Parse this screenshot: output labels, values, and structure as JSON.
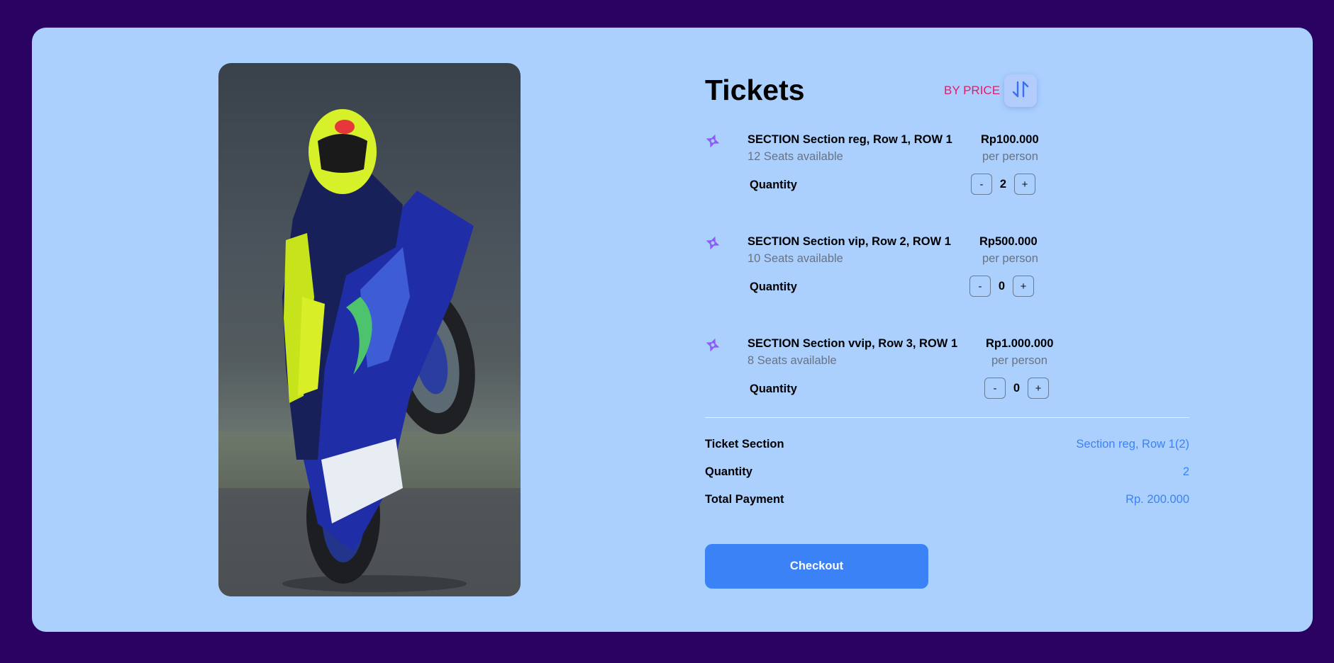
{
  "page": {
    "title": "Tickets",
    "sort_label": "BY PRICE"
  },
  "tickets": [
    {
      "name": "SECTION Section reg, Row 1, ROW 1",
      "seats": "12 Seats available",
      "price": "Rp100.000",
      "per": "per person",
      "quantity_label": "Quantity",
      "minus": "-",
      "plus": "+",
      "quantity": "2"
    },
    {
      "name": "SECTION Section vip, Row 2, ROW 1",
      "seats": "10 Seats available",
      "price": "Rp500.000",
      "per": "per person",
      "quantity_label": "Quantity",
      "minus": "-",
      "plus": "+",
      "quantity": "0"
    },
    {
      "name": "SECTION Section vvip, Row 3, ROW 1",
      "seats": "8 Seats available",
      "price": "Rp1.000.000",
      "per": "per person",
      "quantity_label": "Quantity",
      "minus": "-",
      "plus": "+",
      "quantity": "0"
    }
  ],
  "summary": {
    "section_label": "Ticket Section",
    "section_value": "Section reg, Row 1(2)",
    "quantity_label": "Quantity",
    "quantity_value": "2",
    "total_label": "Total Payment",
    "total_value": "Rp. 200.000"
  },
  "checkout_label": "Checkout",
  "colors": {
    "background": "#2a0262",
    "card": "#abd0fe",
    "accent": "#3b82f6",
    "sort_label": "#e11d6b",
    "ticket_icon": "#8b5cf6"
  },
  "icons": {
    "sort": "sort-arrows-icon",
    "ticket": "ticket-icon"
  }
}
